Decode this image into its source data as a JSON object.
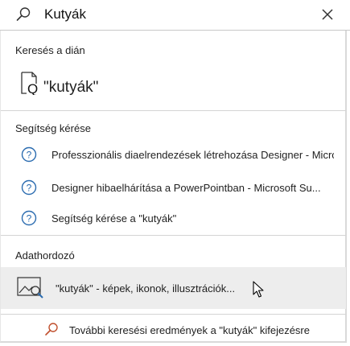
{
  "search": {
    "query": "Kutyák",
    "icon": "search-icon",
    "clear_icon": "close-icon"
  },
  "sections": {
    "find_in_slide": {
      "title": "Keresés a dián",
      "result_label": "\"kutyák\"",
      "icon": "find-document-icon"
    },
    "get_help": {
      "title": "Segítség kérése",
      "items": [
        {
          "label": "Professzionális diaelrendezések létrehozása Designer - Micro",
          "icon": "help-circle-icon"
        },
        {
          "label": "Designer hibaelhárítása a PowerPointban - Microsoft Su...",
          "icon": "help-circle-icon"
        },
        {
          "label": "Segítség kérése a \"kutyák\"",
          "icon": "help-circle-icon"
        }
      ]
    },
    "media": {
      "title": "Adathordozó",
      "items": [
        {
          "label": "\"kutyák\" - képek, ikonok, illusztrációk...",
          "icon": "image-search-icon"
        }
      ]
    },
    "more": {
      "label": "További keresési eredmények a \"kutyák\" kifejezésre",
      "icon": "search-icon"
    }
  },
  "colors": {
    "help_icon": "#2b6cb0",
    "more_search_icon": "#c0502e",
    "hover_background": "#ededed"
  }
}
